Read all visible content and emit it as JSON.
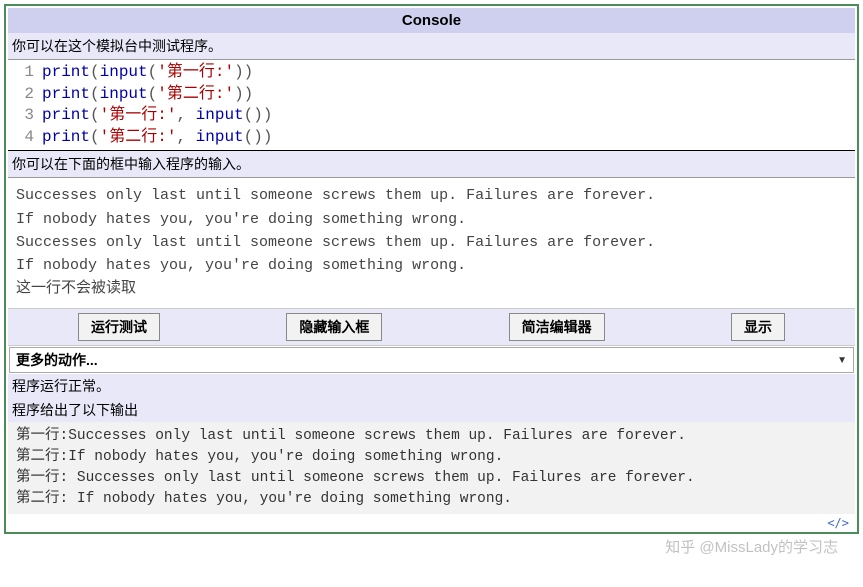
{
  "title": "Console",
  "desc1": "你可以在这个模拟台中测试程序。",
  "code": [
    {
      "n": "1",
      "tokens": [
        {
          "t": "print",
          "c": "fn"
        },
        {
          "t": "(",
          "c": "pn"
        },
        {
          "t": "input",
          "c": "fn"
        },
        {
          "t": "(",
          "c": "pn"
        },
        {
          "t": "'第一行:'",
          "c": "str"
        },
        {
          "t": "))",
          "c": "pn"
        }
      ]
    },
    {
      "n": "2",
      "tokens": [
        {
          "t": "print",
          "c": "fn"
        },
        {
          "t": "(",
          "c": "pn"
        },
        {
          "t": "input",
          "c": "fn"
        },
        {
          "t": "(",
          "c": "pn"
        },
        {
          "t": "'第二行:'",
          "c": "str"
        },
        {
          "t": "))",
          "c": "pn"
        }
      ]
    },
    {
      "n": "3",
      "tokens": [
        {
          "t": "print",
          "c": "fn"
        },
        {
          "t": "(",
          "c": "pn"
        },
        {
          "t": "'第一行:'",
          "c": "str"
        },
        {
          "t": ", ",
          "c": "pn"
        },
        {
          "t": "input",
          "c": "fn"
        },
        {
          "t": "())",
          "c": "pn"
        }
      ]
    },
    {
      "n": "4",
      "tokens": [
        {
          "t": "print",
          "c": "fn"
        },
        {
          "t": "(",
          "c": "pn"
        },
        {
          "t": "'第二行:'",
          "c": "str"
        },
        {
          "t": ", ",
          "c": "pn"
        },
        {
          "t": "input",
          "c": "fn"
        },
        {
          "t": "())",
          "c": "pn"
        }
      ]
    }
  ],
  "desc2": "你可以在下面的框中输入程序的输入。",
  "input_lines": [
    "Successes only last until someone screws them up. Failures are forever.",
    "If nobody hates you, you're doing something wrong.",
    "Successes only last until someone screws them up. Failures are forever.",
    "If nobody hates you, you're doing something wrong.",
    "这一行不会被读取"
  ],
  "buttons": {
    "run": "运行测试",
    "hide": "隐藏输入框",
    "simple": "简洁编辑器",
    "show": "显示"
  },
  "dropdown": "更多的动作...",
  "status1": "程序运行正常。",
  "status2": "程序给出了以下输出",
  "output_lines": [
    "第一行:Successes only last until someone screws them up. Failures are forever.",
    "第二行:If nobody hates you, you're doing something wrong.",
    "第一行: Successes only last until someone screws them up. Failures are forever.",
    "第二行: If nobody hates you, you're doing something wrong."
  ],
  "watermark": "知乎 @MissLady的学习志",
  "footer_icon": "</>"
}
